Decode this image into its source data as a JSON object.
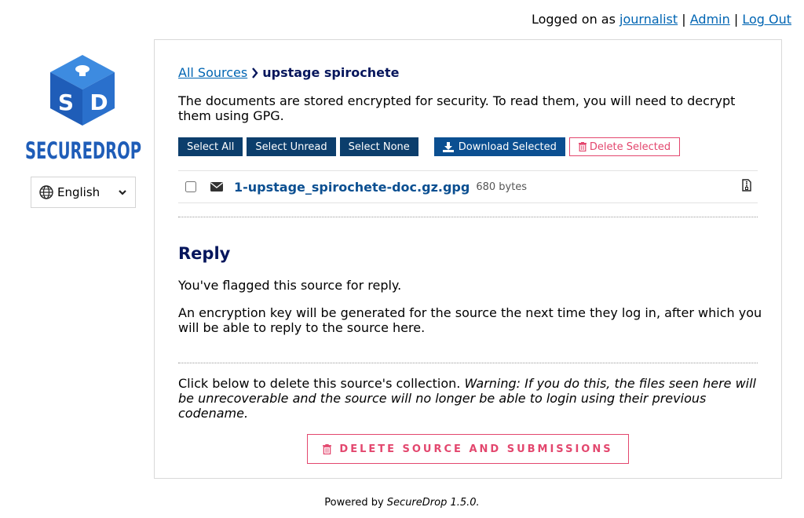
{
  "header": {
    "logged_on_prefix": "Logged on as",
    "username": "journalist",
    "separator": "|",
    "admin_link": "Admin",
    "logout_link": "Log Out"
  },
  "sidebar": {
    "logo_text": "SECUREDROP",
    "logo_monogram": "SD",
    "language": "English"
  },
  "breadcrumb": {
    "all_sources": "All Sources",
    "current_source": "upstage spirochete"
  },
  "main": {
    "storage_note": "The documents are stored encrypted for security. To read them, you will need to decrypt them using GPG.",
    "buttons": {
      "select_all": "Select All",
      "select_unread": "Select Unread",
      "select_none": "Select None",
      "download_selected": "Download Selected",
      "delete_selected": "Delete Selected"
    },
    "files": [
      {
        "name": "1-upstage_spirochete-doc.gz.gpg",
        "size": "680 bytes",
        "icon": "envelope-icon",
        "type_icon": "file-archive-icon"
      }
    ],
    "reply": {
      "heading": "Reply",
      "flagged_text": "You've flagged this source for reply.",
      "key_text": "An encryption key will be generated for the source the next time they log in, after which you will be able to reply to the source here."
    },
    "delete_section": {
      "intro": "Click below to delete this source's collection.",
      "warning": "Warning: If you do this, the files seen here will be unrecoverable and the source will no longer be able to login using their previous codename.",
      "button": "DELETE SOURCE AND SUBMISSIONS"
    }
  },
  "footer": {
    "powered_by": "Powered by",
    "product": "SecureDrop 1.5.0."
  },
  "colors": {
    "navy": "#0c3e6c",
    "link": "#0065b3",
    "danger": "#e3476e",
    "heading": "#06165c"
  }
}
